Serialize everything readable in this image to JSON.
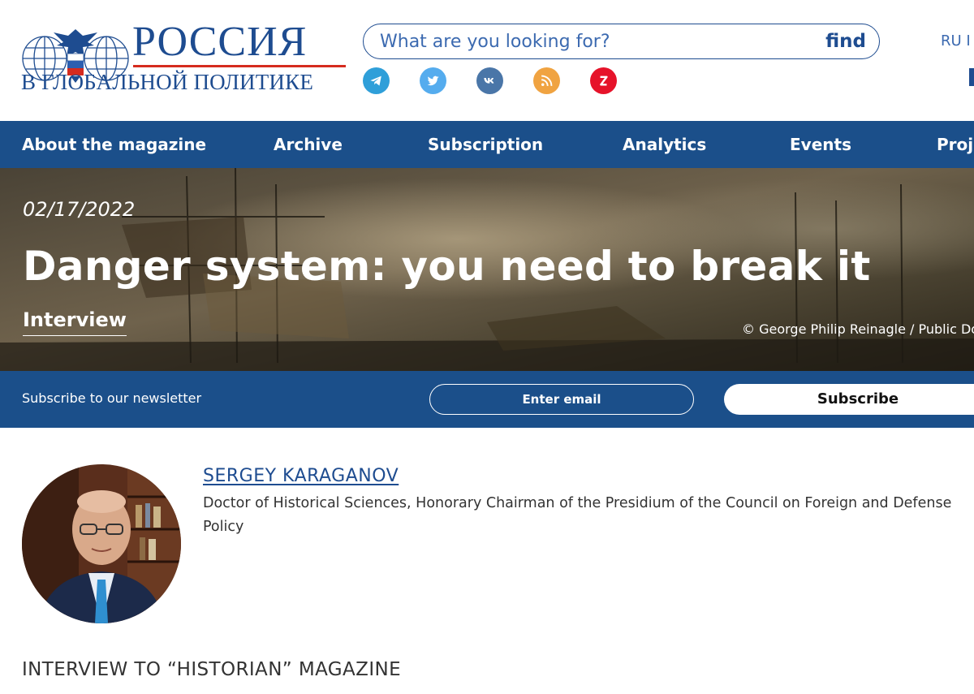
{
  "logo": {
    "title": "РОССИЯ",
    "subtitle": "В ГЛОБАЛЬНОЙ ПОЛИТИКЕ"
  },
  "search": {
    "placeholder": "What are you looking for?",
    "button": "find"
  },
  "socials": [
    {
      "icon": "telegram-icon",
      "color": "#2f9fd9"
    },
    {
      "icon": "twitter-icon",
      "color": "#55acee"
    },
    {
      "icon": "vk-icon",
      "color": "#4a76a8"
    },
    {
      "icon": "rss-icon",
      "color": "#f0a341"
    },
    {
      "icon": "zen-icon",
      "color": "#e6132a"
    }
  ],
  "lang": {
    "current": "RU I"
  },
  "nav": {
    "items": [
      "About the magazine",
      "Archive",
      "Subscription",
      "Analytics",
      "Events",
      "Proje"
    ]
  },
  "article": {
    "date": "02/17/2022",
    "title": "Danger system: you need to break it",
    "tag": "Interview",
    "credit": "© George Philip Reinagle / Public Dor"
  },
  "newsletter": {
    "label": "Subscribe to our newsletter",
    "email_placeholder": "Enter email",
    "button": "Subscribe"
  },
  "author": {
    "name": "SERGEY KARAGANOV",
    "description": "Doctor of Historical Sciences, Honorary Chairman of the Presidium of the Council on Foreign and Defense Policy"
  },
  "subheading": "INTERVIEW TO “HISTORIAN” MAGAZINE",
  "colors": {
    "brand_blue": "#1b4f8a",
    "logo_blue": "#1e4c90",
    "logo_red": "#d52b1e"
  }
}
